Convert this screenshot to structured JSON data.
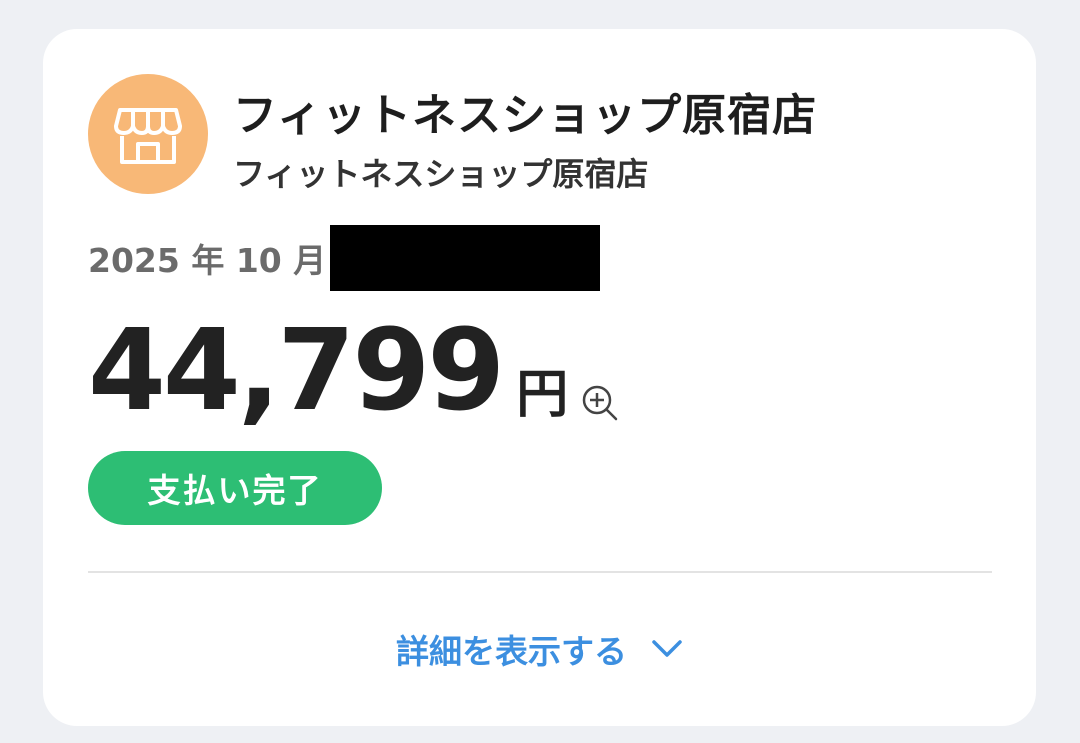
{
  "store": {
    "name": "フィットネスショップ原宿店",
    "sub_name": "フィットネスショップ原宿店",
    "icon": "storefront-icon",
    "avatar_color": "#f8b877"
  },
  "transaction": {
    "date_prefix": "2025 年 10 月",
    "amount": "44,799",
    "currency": "円",
    "zoom_icon": "zoom-in-icon"
  },
  "status": {
    "label": "支払い完了",
    "color": "#2dbe74"
  },
  "footer": {
    "details_label": "詳細を表示する",
    "chevron_icon": "chevron-down-icon",
    "link_color": "#3c8fe0"
  }
}
